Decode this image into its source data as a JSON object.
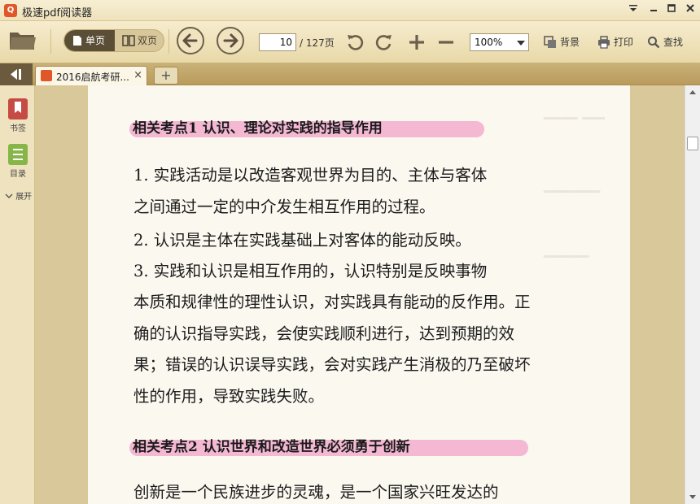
{
  "app": {
    "logo_glyph": "Q",
    "title": "极速pdf阅读器",
    "accent": "#e0582a"
  },
  "window_controls": {
    "menu_icon": "menu-down-icon",
    "minimize_icon": "minimize-icon",
    "maximize_icon": "maximize-icon",
    "close_icon": "close-icon"
  },
  "toolbar": {
    "single_page_label": "单页",
    "double_page_label": "双页",
    "current_page": "10",
    "total_pages": "/ 127页",
    "zoom": "100%",
    "background_label": "背景",
    "print_label": "打印",
    "find_label": "查找"
  },
  "tabs": {
    "active_tab_label": "2016启航考研...",
    "close_glyph": "×",
    "new_tab_glyph": "+"
  },
  "sidebar": {
    "bookmark_label": "书签",
    "toc_label": "目录",
    "expand_label": "展开"
  },
  "document": {
    "sections": [
      {
        "heading": "相关考点1    认识、理论对实践的指导作用",
        "lines": [
          "    1. 实践活动是以改造客观世界为目的、主体与客体",
          "之间通过一定的中介发生相互作用的过程。",
          "    2. 认识是主体在实践基础上对客体的能动反映。",
          "    3. 实践和认识是相互作用的，认识特别是反映事物",
          "本质和规律性的理性认识，对实践具有能动的反作用。正",
          "确的认识指导实践，会使实践顺利进行，达到预期的效",
          "果；错误的认识误导实践，会对实践产生消极的乃至破坏",
          "性的作用，导致实践失败。"
        ]
      },
      {
        "heading": "相关考点2    认识世界和改造世界必须勇于创新",
        "lines": [
          "    创新是一个民族进步的灵魂，是一个国家兴旺发达的"
        ]
      }
    ]
  },
  "scrollbar": {
    "position_fraction": 0.1
  }
}
